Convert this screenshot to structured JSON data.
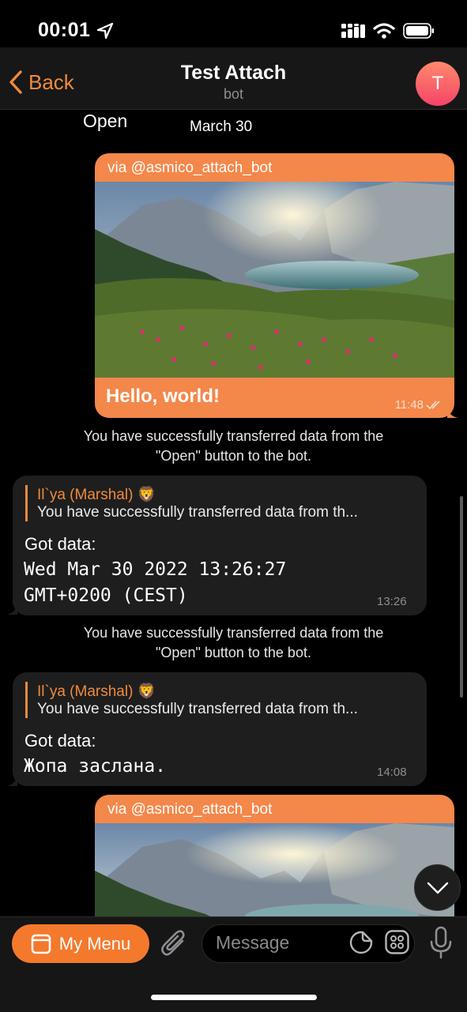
{
  "status": {
    "time": "00:01"
  },
  "header": {
    "back_label": "Back",
    "title": "Test Attach",
    "subtitle": "bot",
    "avatar_letter": "T"
  },
  "top_fragment": {
    "open_text": "Open",
    "date": "March 30"
  },
  "messages": [
    {
      "type": "outgoing_photo",
      "via_prefix": "via ",
      "via_bot": "@asmico_attach_bot",
      "text": "Hello, world!",
      "time": "11:48"
    },
    {
      "type": "service",
      "line1": "You have successfully transferred data from the",
      "line2": "\"Open\" button to the bot."
    },
    {
      "type": "incoming",
      "reply_name": "Il`ya (Marshal) 🦁",
      "reply_text": "You have successfully transferred data from th...",
      "label": "Got data:",
      "data_line1": "Wed Mar 30 2022 13:26:27",
      "data_line2": "GMT+0200 (CEST)",
      "time": "13:26"
    },
    {
      "type": "service",
      "line1": "You have successfully transferred data from the",
      "line2": "\"Open\" button to the bot."
    },
    {
      "type": "incoming",
      "reply_name": "Il`ya (Marshal) 🦁",
      "reply_text": "You have successfully transferred data from th...",
      "label": "Got data:",
      "data_line1": "Жопа заслана.",
      "time": "14:08"
    },
    {
      "type": "outgoing_photo",
      "via_prefix": "via ",
      "via_bot": "@asmico_attach_bot"
    }
  ],
  "composer": {
    "menu_label": "My Menu",
    "placeholder": "Message"
  },
  "colors": {
    "accent": "#f08a3c",
    "bubble_out": "#f4874a",
    "bubble_in": "#1e1e1e",
    "menu_button": "#f4792c"
  }
}
